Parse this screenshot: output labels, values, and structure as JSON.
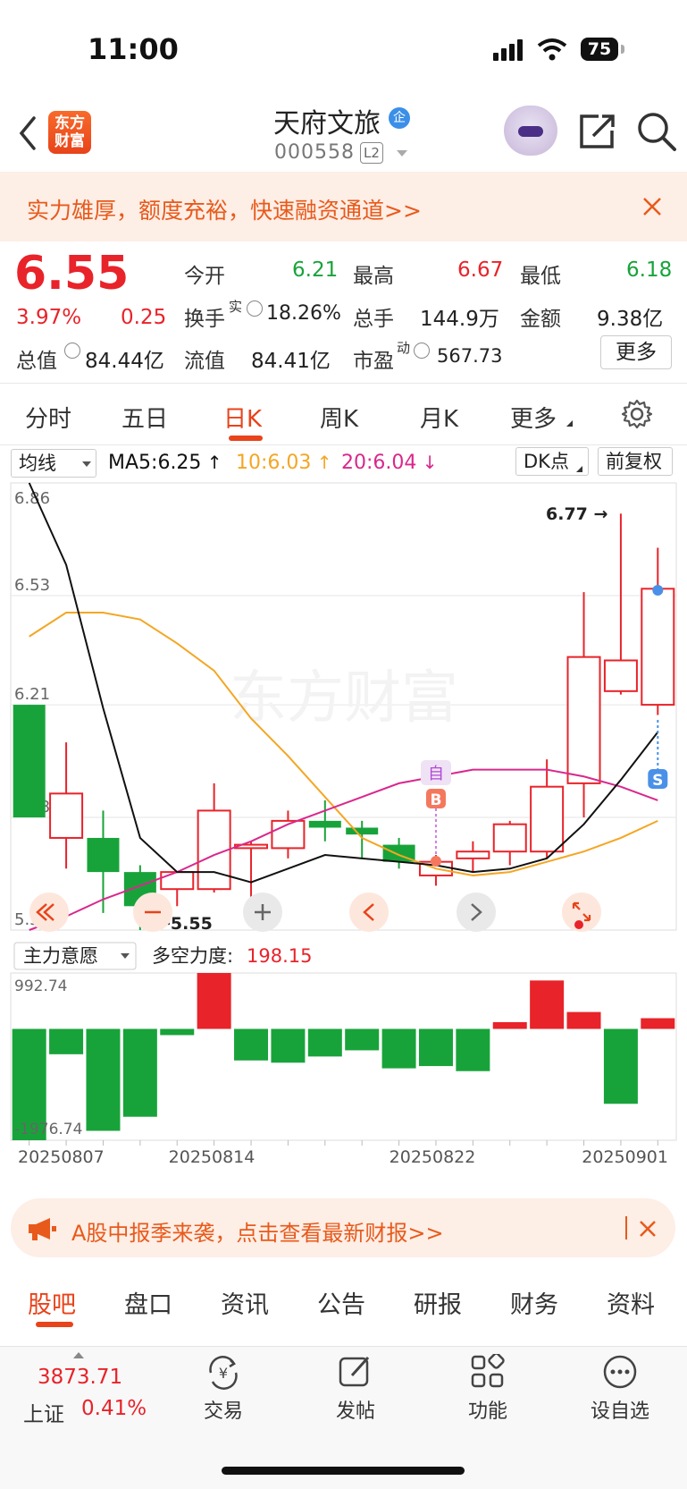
{
  "status_bar": {
    "time": "11:00",
    "battery": "75"
  },
  "header": {
    "logo_text": "东方\n财富",
    "stock_name": "天府文旅",
    "qi_badge": "企",
    "stock_code": "000558",
    "level": "L2",
    "icons": [
      "back-icon",
      "robot-avatar",
      "share-icon",
      "search-icon"
    ]
  },
  "promo_banner": {
    "text": "实力雄厚，额度充裕，快速融资通道>>"
  },
  "quote": {
    "price": "6.55",
    "change_pct": "3.97%",
    "change_amt": "0.25",
    "open_label": "今开",
    "open": "6.21",
    "high_label": "最高",
    "high": "6.67",
    "low_label": "最低",
    "low": "6.18",
    "turnover_label": "换手",
    "turnover_sup": "实",
    "turnover": "18.26%",
    "volume_label": "总手",
    "volume": "144.9万",
    "amount_label": "金额",
    "amount": "9.38亿",
    "mktcap_label": "总值",
    "mktcap": "84.44亿",
    "float_label": "流值",
    "float": "84.41亿",
    "pe_label": "市盈",
    "pe_sup": "动",
    "pe": "567.73",
    "more_label": "更多"
  },
  "tabs": [
    {
      "label": "分时"
    },
    {
      "label": "五日"
    },
    {
      "label": "日K",
      "active": true
    },
    {
      "label": "周K"
    },
    {
      "label": "月K"
    },
    {
      "label": "更多"
    }
  ],
  "chart_toolbar": {
    "indicator": "均线",
    "ma5": "MA5:6.25",
    "ma10": "10:6.03",
    "ma20": "20:6.04",
    "dk_label": "DK点",
    "adjust_label": "前复权"
  },
  "chart_labels": {
    "watermark": "东方财富",
    "high_marker": "6.77",
    "low_marker": "5.55",
    "zi": "自",
    "b_mark": "B",
    "s_mark": "S"
  },
  "sub_toolbar": {
    "indicator": "主力意愿",
    "force_label": "多空力度:",
    "force_value": "198.15"
  },
  "date_labels": [
    "20250807",
    "20250814",
    "20250822",
    "20250901"
  ],
  "colors": {
    "up": "#e8232a",
    "down": "#18a33a",
    "accent": "#e8431a",
    "ma5": "#111111",
    "ma10": "#f4a623",
    "ma20": "#d9288c"
  },
  "chart_data": [
    {
      "type": "candlestick",
      "title": "",
      "ylim": [
        5.55,
        6.86
      ],
      "y_ticks": [
        "6.86",
        "6.53",
        "6.21",
        "5.88",
        "5.55"
      ],
      "candles": [
        {
          "o": 6.21,
          "h": 6.21,
          "l": 5.88,
          "c": 5.88
        },
        {
          "o": 5.82,
          "h": 6.1,
          "l": 5.73,
          "c": 5.95
        },
        {
          "o": 5.82,
          "h": 5.9,
          "l": 5.6,
          "c": 5.72
        },
        {
          "o": 5.72,
          "h": 5.74,
          "l": 5.55,
          "c": 5.62
        },
        {
          "o": 5.67,
          "h": 5.72,
          "l": 5.62,
          "c": 5.72
        },
        {
          "o": 5.67,
          "h": 5.98,
          "l": 5.66,
          "c": 5.9
        },
        {
          "o": 5.79,
          "h": 5.81,
          "l": 5.61,
          "c": 5.8
        },
        {
          "o": 5.79,
          "h": 5.9,
          "l": 5.76,
          "c": 5.87
        },
        {
          "o": 5.87,
          "h": 5.93,
          "l": 5.81,
          "c": 5.85
        },
        {
          "o": 5.85,
          "h": 5.87,
          "l": 5.76,
          "c": 5.83
        },
        {
          "o": 5.8,
          "h": 5.82,
          "l": 5.73,
          "c": 5.75
        },
        {
          "o": 5.71,
          "h": 5.77,
          "l": 5.68,
          "c": 5.75
        },
        {
          "o": 5.76,
          "h": 5.81,
          "l": 5.72,
          "c": 5.78
        },
        {
          "o": 5.78,
          "h": 5.87,
          "l": 5.74,
          "c": 5.86
        },
        {
          "o": 5.78,
          "h": 6.05,
          "l": 5.76,
          "c": 5.97
        },
        {
          "o": 5.98,
          "h": 6.54,
          "l": 5.88,
          "c": 6.35
        },
        {
          "o": 6.25,
          "h": 6.77,
          "l": 6.24,
          "c": 6.34
        },
        {
          "o": 6.21,
          "h": 6.67,
          "l": 6.18,
          "c": 6.55
        }
      ],
      "ma5": [
        6.86,
        6.62,
        6.2,
        5.82,
        5.72,
        5.72,
        5.69,
        5.73,
        5.77,
        5.76,
        5.75,
        5.74,
        5.72,
        5.73,
        5.76,
        5.86,
        5.99,
        6.13
      ],
      "ma10": [
        6.41,
        6.48,
        6.48,
        6.46,
        6.39,
        6.31,
        6.17,
        6.06,
        5.94,
        5.82,
        5.77,
        5.73,
        5.71,
        5.72,
        5.75,
        5.78,
        5.82,
        5.87
      ],
      "ma20": [
        5.55,
        5.59,
        5.64,
        5.68,
        5.72,
        5.77,
        5.81,
        5.86,
        5.9,
        5.94,
        5.98,
        6.0,
        6.02,
        6.02,
        6.02,
        6.0,
        5.97,
        5.93
      ]
    },
    {
      "type": "bar",
      "title": "主力意愿",
      "ylim": [
        -1976.74,
        992.74
      ],
      "y_ticks": [
        "992.74",
        "-1976.74"
      ],
      "values": [
        -1976.74,
        -450,
        -1810,
        -1560,
        -110,
        992.74,
        -560,
        -600,
        -490,
        -380,
        -700,
        -660,
        -750,
        120,
        860,
        300,
        -1330,
        190
      ]
    }
  ],
  "bottom_banner": {
    "text": "A股中报季来袭，点击查看最新财报>>"
  },
  "bottom_tabs": [
    "股吧",
    "盘口",
    "资讯",
    "公告",
    "研报",
    "财务",
    "资料"
  ],
  "bottom_bar": {
    "index_value": "3873.71",
    "index_name": "上证",
    "index_change": "0.41%",
    "items": [
      "交易",
      "发帖",
      "功能",
      "设自选"
    ]
  }
}
